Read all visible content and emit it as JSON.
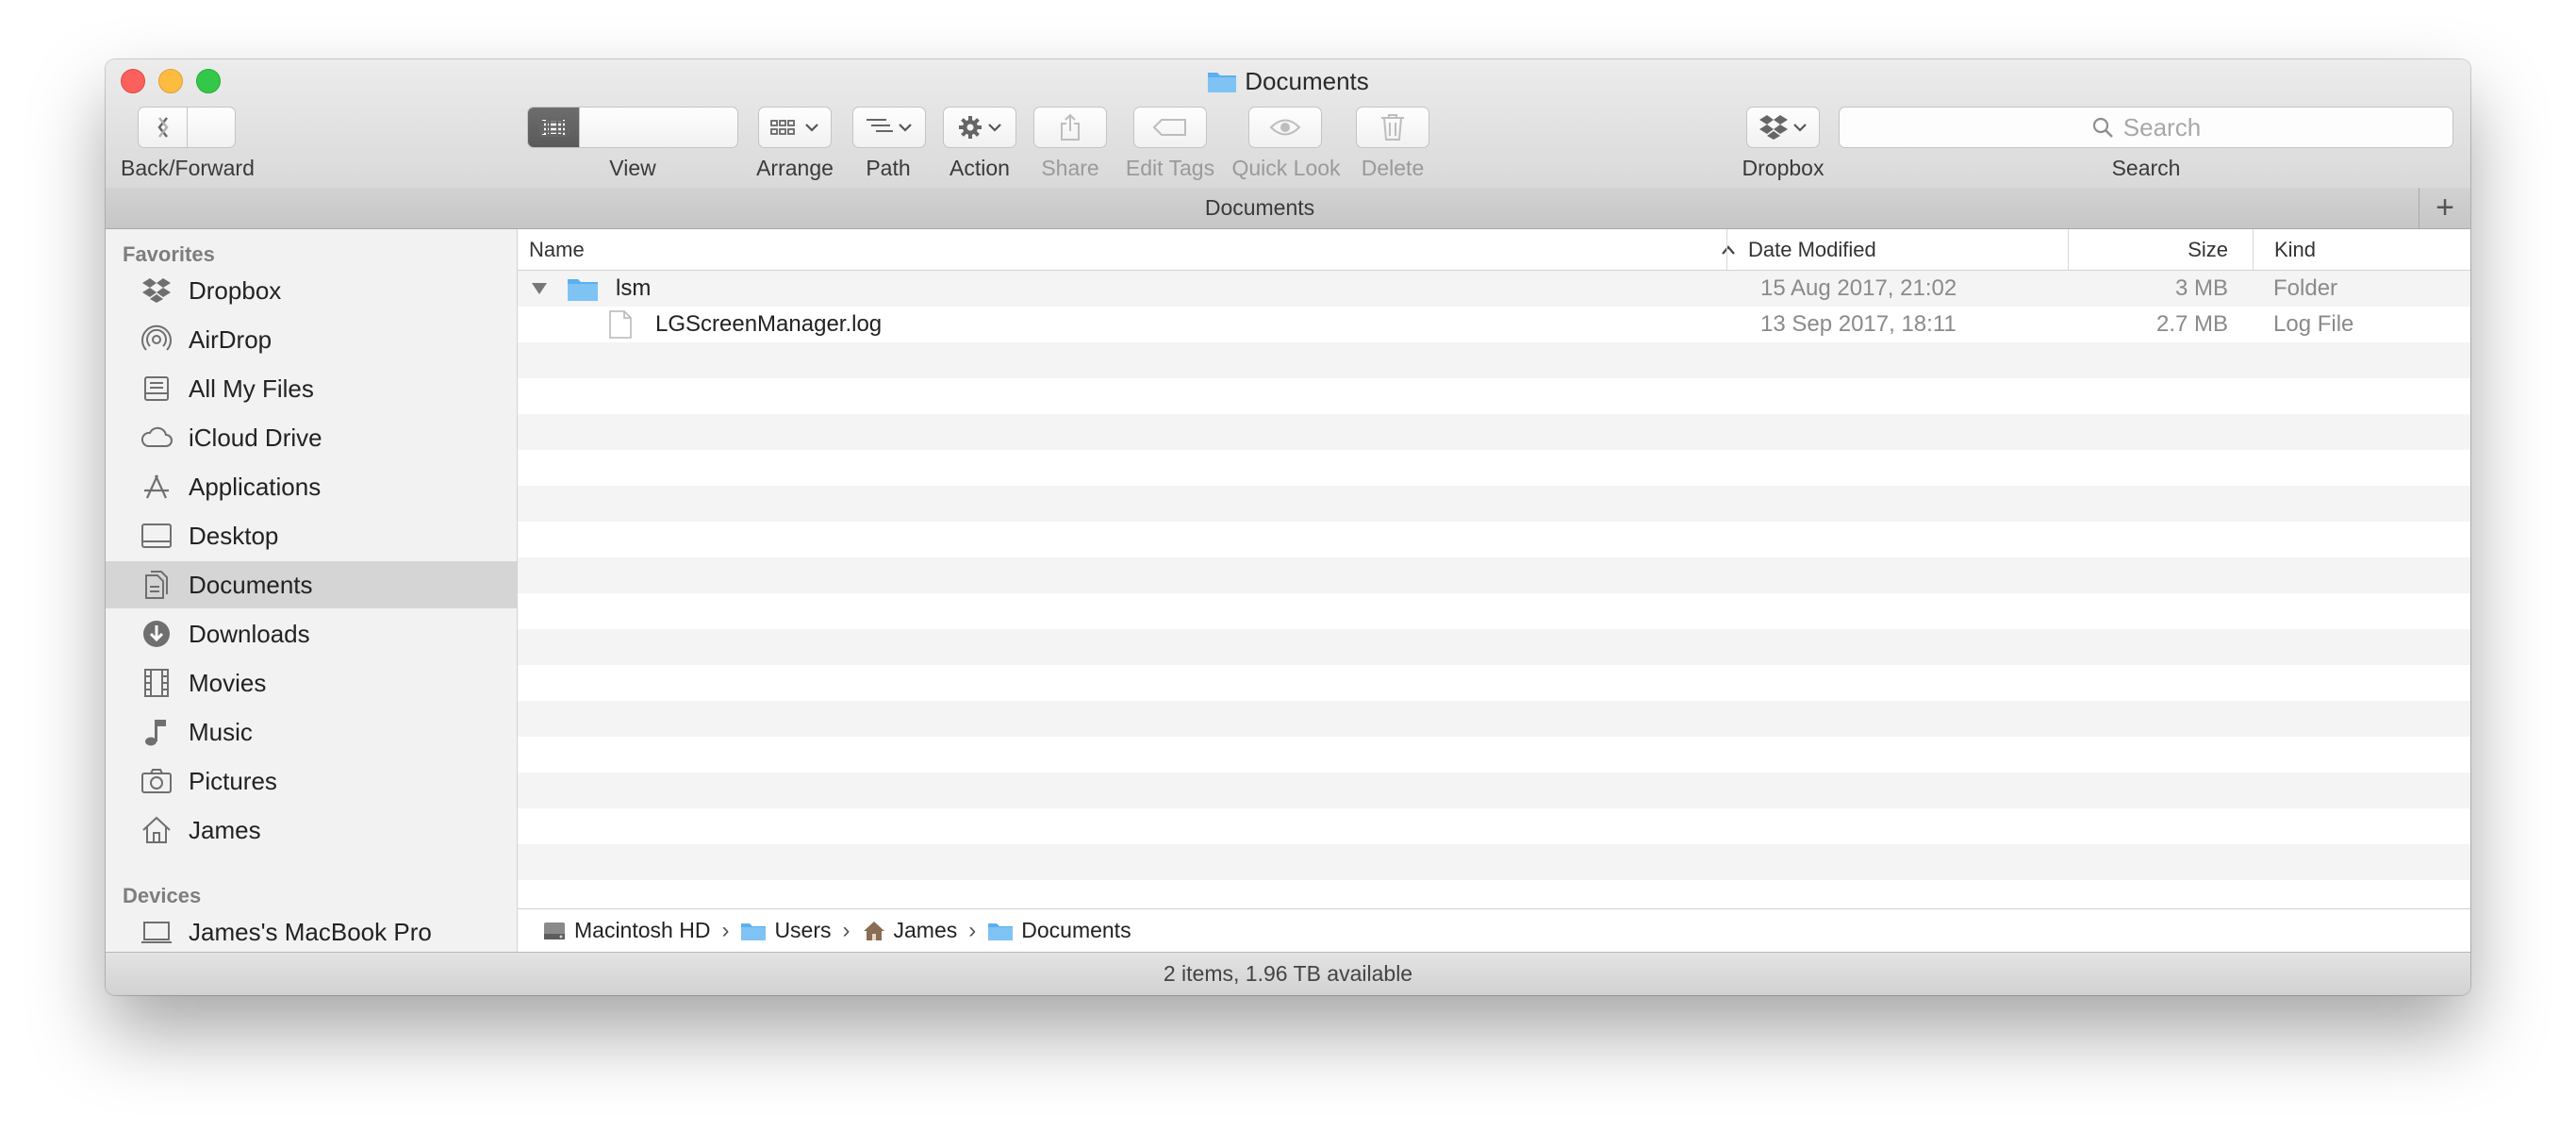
{
  "window": {
    "title": "Documents"
  },
  "toolbar": {
    "back_forward_label": "Back/Forward",
    "view_label": "View",
    "arrange_label": "Arrange",
    "path_label": "Path",
    "action_label": "Action",
    "share_label": "Share",
    "edit_tags_label": "Edit Tags",
    "quick_look_label": "Quick Look",
    "delete_label": "Delete",
    "dropbox_label": "Dropbox",
    "search_label": "Search",
    "search_placeholder": "Search"
  },
  "tabbar": {
    "title": "Documents",
    "add": "+"
  },
  "sidebar": {
    "favorites_heading": "Favorites",
    "devices_heading": "Devices",
    "favorites": [
      {
        "label": "Dropbox",
        "icon": "dropbox-icon"
      },
      {
        "label": "AirDrop",
        "icon": "airdrop-icon"
      },
      {
        "label": "All My Files",
        "icon": "all-files-icon"
      },
      {
        "label": "iCloud Drive",
        "icon": "cloud-icon"
      },
      {
        "label": "Applications",
        "icon": "applications-icon"
      },
      {
        "label": "Desktop",
        "icon": "desktop-icon"
      },
      {
        "label": "Documents",
        "icon": "documents-icon",
        "selected": true
      },
      {
        "label": "Downloads",
        "icon": "downloads-icon"
      },
      {
        "label": "Movies",
        "icon": "film-icon"
      },
      {
        "label": "Music",
        "icon": "music-note-icon"
      },
      {
        "label": "Pictures",
        "icon": "camera-icon"
      },
      {
        "label": "James",
        "icon": "home-icon"
      }
    ],
    "devices": [
      {
        "label": "James's MacBook Pro",
        "icon": "laptop-icon"
      }
    ]
  },
  "columns": {
    "name": "Name",
    "date": "Date Modified",
    "size": "Size",
    "kind": "Kind"
  },
  "files": [
    {
      "name": "lsm",
      "date": "15 Aug 2017, 21:02",
      "size": "3 MB",
      "kind": "Folder",
      "icon": "folder-icon",
      "expanded": true
    },
    {
      "name": "LGScreenManager.log",
      "date": "13 Sep 2017, 18:11",
      "size": "2.7 MB",
      "kind": "Log File",
      "icon": "document-icon"
    }
  ],
  "path": [
    {
      "label": "Macintosh HD",
      "icon": "hard-drive-icon"
    },
    {
      "label": "Users",
      "icon": "folder-icon"
    },
    {
      "label": "James",
      "icon": "home-icon"
    },
    {
      "label": "Documents",
      "icon": "folder-icon"
    }
  ],
  "status": "2 items, 1.96 TB available",
  "colors": {
    "folder_blue": "#5bb0ee",
    "selection_gray": "#d5d5d5",
    "stripe": "#f4f4f4"
  }
}
